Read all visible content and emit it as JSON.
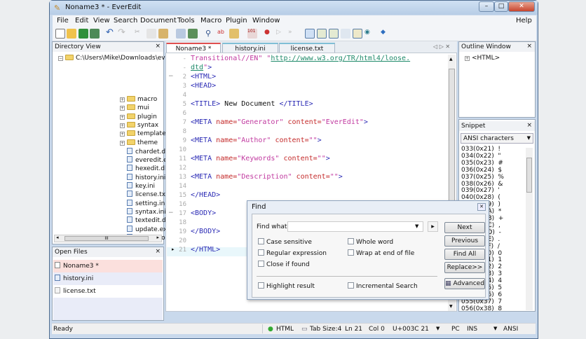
{
  "window": {
    "title": "Noname3 * - EverEdit",
    "controls": [
      "–",
      "□",
      "✕"
    ]
  },
  "menu": [
    "File",
    "Edit",
    "View",
    "Search",
    "Document",
    "Tools",
    "Macro",
    "Plugin",
    "Window"
  ],
  "help": "Help",
  "directory": {
    "title": "Directory View",
    "close": "×",
    "root": "C:\\Users\\Mike\\Downloads\\everec",
    "folders": [
      "macro",
      "mui",
      "plugin",
      "syntax",
      "template",
      "theme"
    ],
    "files": [
      "chardet.dll",
      "everedit.exe",
      "hexedit.dll",
      "history.ini",
      "key.ini",
      "license.txt",
      "setting.ini",
      "syntax.ini",
      "textedit.dll",
      "update.exe",
      "update.log"
    ],
    "scroll_grip": "III"
  },
  "open_files": {
    "title": "Open Files",
    "close": "×",
    "items": [
      "Noname3 *",
      "history.ini",
      "license.txt"
    ]
  },
  "tabs": [
    "Noname3 *",
    "history.ini",
    "license.txt"
  ],
  "tab_nav": "◁ ▷ ✕",
  "editor": {
    "lines": [
      {
        "n": "-",
        "html": "<span class='str'>Transitional//EN\"</span> <span class='str'>\"</span><span class='url'>http://www.w3.org/TR/html4/loose.</span>"
      },
      {
        "n": "-",
        "html": "<span class='url'>dtd</span><span class='str'>\"</span><span class='tag'>&gt;</span>"
      },
      {
        "n": "2",
        "html": "<span class='tag'>&lt;HTML&gt;</span>"
      },
      {
        "n": "3",
        "html": "<span class='tag'>&lt;HEAD&gt;</span>"
      },
      {
        "n": "4",
        "html": ""
      },
      {
        "n": "5",
        "html": "<span class='tag'>&lt;TITLE&gt;</span> New Document <span class='tag'>&lt;/TITLE&gt;</span>"
      },
      {
        "n": "6",
        "html": ""
      },
      {
        "n": "7",
        "html": "<span class='tag'>&lt;META</span> <span class='attr'>name=</span><span class='str'>\"Generator\"</span> <span class='attr'>content=</span><span class='str'>\"EverEdit\"</span><span class='tag'>&gt;</span>"
      },
      {
        "n": "8",
        "html": ""
      },
      {
        "n": "9",
        "html": "<span class='tag'>&lt;META</span> <span class='attr'>name=</span><span class='str'>\"Author\"</span> <span class='attr'>content=</span><span class='str'>\"\"</span><span class='tag'>&gt;</span>"
      },
      {
        "n": "10",
        "html": ""
      },
      {
        "n": "11",
        "html": "<span class='tag'>&lt;META</span> <span class='attr'>name=</span><span class='str'>\"Keywords\"</span> <span class='attr'>content=</span><span class='str'>\"\"</span><span class='tag'>&gt;</span>"
      },
      {
        "n": "12",
        "html": ""
      },
      {
        "n": "13",
        "html": "<span class='tag'>&lt;META</span> <span class='attr'>name=</span><span class='str'>\"Description\"</span> <span class='attr'>content=</span><span class='str'>\"\"</span><span class='tag'>&gt;</span>"
      },
      {
        "n": "14",
        "html": ""
      },
      {
        "n": "15",
        "html": "<span class='tag'>&lt;/HEAD&gt;</span>"
      },
      {
        "n": "16",
        "html": ""
      },
      {
        "n": "17",
        "html": "<span class='tag'>&lt;BODY&gt;</span>"
      },
      {
        "n": "18",
        "html": ""
      },
      {
        "n": "19",
        "html": "<span class='tag'>&lt;/BODY&gt;</span>"
      },
      {
        "n": "20",
        "html": ""
      },
      {
        "n": "21",
        "html": "<span class='tag'>&lt;/HTML&gt;</span>"
      }
    ]
  },
  "outline": {
    "title": "Outline Window",
    "close": "×",
    "item": "<HTML>"
  },
  "snippet": {
    "title": "Snippet",
    "close": "×",
    "category": "ANSI characters",
    "items": [
      "033(0x21)  !",
      "034(0x22)  \"",
      "035(0x23)  #",
      "036(0x24)  $",
      "037(0x25)  %",
      "038(0x26)  &",
      "039(0x27)  '",
      "040(0x28)  (",
      "041(0x29)  )",
      "042(0x2A)  *",
      "043(0x2B)  +",
      "044(0x2C)  ,",
      "045(0x2D)  -",
      "046(0x2E)  .",
      "047(0x2F)  /",
      "048(0x30)  0",
      "049(0x31)  1",
      "050(0x32)  2",
      "051(0x33)  3",
      "052(0x34)  4",
      "053(0x35)  5",
      "054(0x36)  6",
      "055(0x37)  7",
      "056(0x38)  8"
    ]
  },
  "find": {
    "title": "Find",
    "close": "✕",
    "find_what_label": "Find what:",
    "find_what_value": "",
    "options": [
      "Case sensitive",
      "Regular expression",
      "Close if found",
      "Whole word",
      "Wrap at end of file",
      "Highlight result",
      "Incremental Search"
    ],
    "buttons": [
      "Next",
      "Previous",
      "Find All",
      "Replace>>",
      "Advanced"
    ]
  },
  "status": {
    "ready": "Ready",
    "syntax": "HTML",
    "tab_size": "Tab Size:4",
    "line": "Ln 21",
    "col": "Col 0",
    "char": "U+003C 21",
    "eol": "PC",
    "mode": "INS",
    "encoding": "ANSI"
  }
}
